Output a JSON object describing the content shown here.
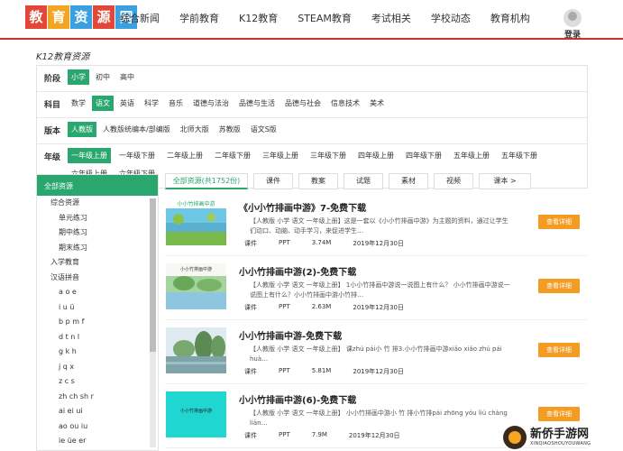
{
  "header": {
    "logo_chars": [
      "教",
      "育",
      "资",
      "源",
      "网"
    ],
    "logo_colors": [
      "#e2473a",
      "#f4a623",
      "#3aa0e0",
      "#e2473a",
      "#3aa0e0"
    ],
    "nav": [
      "综合新闻",
      "学前教育",
      "K12教育",
      "STEAM教育",
      "考试相关",
      "学校动态",
      "教育机构"
    ],
    "login": "登录"
  },
  "section_title": "K12教育资源",
  "filters": {
    "stage": {
      "label": "阶段",
      "options": [
        "小学",
        "初中",
        "高中"
      ],
      "active": 0
    },
    "subject": {
      "label": "科目",
      "options": [
        "数学",
        "语文",
        "英语",
        "科学",
        "音乐",
        "道德与法治",
        "品德与生活",
        "品德与社会",
        "信息技术",
        "美术"
      ],
      "active": 1
    },
    "edition": {
      "label": "版本",
      "options": [
        "人教版",
        "人教版统编本/部编版",
        "北师大版",
        "苏教版",
        "语文S版"
      ],
      "active": 0
    },
    "grade": {
      "label": "年级",
      "options": [
        "一年级上册",
        "一年级下册",
        "二年级上册",
        "二年级下册",
        "三年级上册",
        "三年级下册",
        "四年级上册",
        "四年级下册",
        "五年级上册",
        "五年级下册",
        "六年级上册",
        "六年级下册"
      ],
      "active": 0
    }
  },
  "sidebar": {
    "head": "全部资源",
    "items": [
      {
        "label": "综合资源",
        "level": 1
      },
      {
        "label": "单元练习",
        "level": 2
      },
      {
        "label": "期中练习",
        "level": 2
      },
      {
        "label": "期末练习",
        "level": 2
      },
      {
        "label": "入学教育",
        "level": 1
      },
      {
        "label": "汉语拼音",
        "level": 1
      },
      {
        "label": "a o e",
        "level": 2
      },
      {
        "label": "i u ü",
        "level": 2
      },
      {
        "label": "b p m f",
        "level": 2
      },
      {
        "label": "d t n l",
        "level": 2
      },
      {
        "label": "g k h",
        "level": 2
      },
      {
        "label": "j q x",
        "level": 2
      },
      {
        "label": "z c s",
        "level": 2
      },
      {
        "label": "zh ch sh r",
        "level": 2
      },
      {
        "label": "ai ei ui",
        "level": 2
      },
      {
        "label": "ao ou iu",
        "level": 2
      },
      {
        "label": "ie üe er",
        "level": 2
      }
    ]
  },
  "tabs": [
    "全部资源(共1752份)",
    "课件",
    "教案",
    "试题",
    "素材",
    "视频",
    "课本 >"
  ],
  "items": [
    {
      "title": "《小小竹排画中游》7-免费下载",
      "desc": "【人教版 小学 语文 一年级上册】这是一套以《小小竹排画中游》为主题的资料，通过让学生们动口、动脑、动手学习，来促进学生… ",
      "type": "课件",
      "format": "PPT",
      "size": "3.74M",
      "date": "2019年12月30日",
      "button": "查看详细",
      "thumb_caption": "小小竹排画中游"
    },
    {
      "title": "小小竹排画中游(2)-免费下载",
      "desc": "【人教版 小学 语文 一年级上册】 1小小竹排画中游说一说图上有什么？ 小小竹排画中游说一说图上有什么？小小竹排画中游小竹排… ",
      "type": "课件",
      "format": "PPT",
      "size": "2.63M",
      "date": "2019年12月30日",
      "button": "查看详细",
      "thumb_caption": "小小竹排画中游"
    },
    {
      "title": "小小竹排画中游-免费下载",
      "desc": "【人教版 小学 语文 一年级上册】 课zhú pái小 竹 排3.小小竹排画中游xiǎo xiǎo zhú pái huà… ",
      "type": "课件",
      "format": "PPT",
      "size": "5.81M",
      "date": "2019年12月30日",
      "button": "查看详细",
      "thumb_caption": ""
    },
    {
      "title": "小小竹排画中游(6)-免费下载",
      "desc": "【人教版 小学 语文 一年级上册】 小小竹排画中游小 竹 排小竹排pái zhōng yóu liú chàng liàn…",
      "type": "课件",
      "format": "PPT",
      "size": "7.9M",
      "date": "2019年12月30日",
      "button": "查看详细",
      "thumb_caption": "小小竹排画中游"
    }
  ],
  "watermark": {
    "main": "新侨手游网",
    "sub": "XINQIAOSHOUYOUWANG"
  }
}
